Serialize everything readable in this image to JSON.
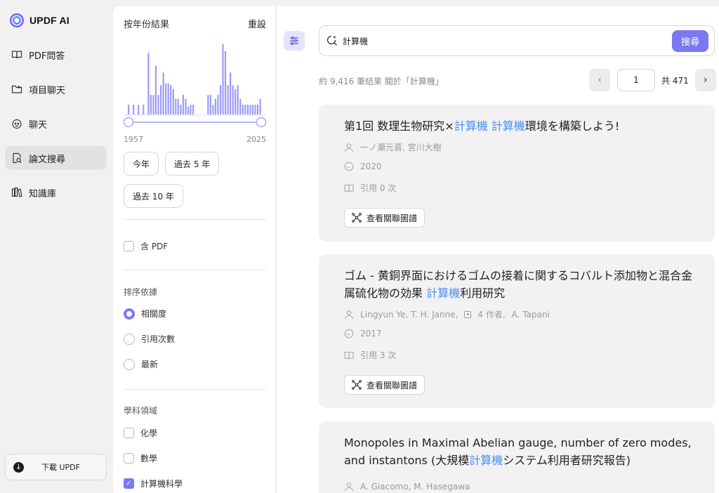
{
  "app": {
    "name": "UPDF AI"
  },
  "nav": [
    {
      "label": "PDF問答",
      "icon": "book-icon"
    },
    {
      "label": "項目聊天",
      "icon": "folder-icon"
    },
    {
      "label": "聊天",
      "icon": "chat-bot-icon"
    },
    {
      "label": "論文搜尋",
      "icon": "paper-search-icon",
      "active": true
    },
    {
      "label": "知識庫",
      "icon": "library-icon"
    }
  ],
  "download": {
    "label": "下載 UPDF"
  },
  "filters": {
    "year_title": "按年份結果",
    "reset_label": "重設",
    "year_min": "1957",
    "year_max": "2025",
    "year_chips": [
      "今年",
      "過去 5 年",
      "過去 10 年"
    ],
    "pdf_label": "含 PDF",
    "sort_title": "排序依據",
    "sort_options": [
      "相關度",
      "引用次數",
      "最新"
    ],
    "sort_selected": "相關度",
    "field_title": "學科領域",
    "fields": [
      {
        "label": "化學",
        "checked": false
      },
      {
        "label": "數學",
        "checked": false
      },
      {
        "label": "計算機科學",
        "checked": true
      }
    ],
    "year_histogram": [
      0.1,
      0,
      0.1,
      0,
      0.1,
      0,
      0.1,
      0,
      0.63,
      0.2,
      0.2,
      0.5,
      0.2,
      0.3,
      0.43,
      0.32,
      0.32,
      0.3,
      0.26,
      0.16,
      0.16,
      0.1,
      0.2,
      0.16,
      0.08,
      0.1,
      0.1,
      0,
      0,
      0,
      0,
      0,
      0.2,
      0.2,
      0.1,
      0.16,
      0.2,
      0.3,
      0.72,
      0.65,
      0.3,
      0.43,
      0.3,
      0.26,
      0.3,
      0.16,
      0.1,
      0.1,
      0.1,
      0.1,
      0.1,
      0.1,
      0.1,
      0.16
    ]
  },
  "search": {
    "query": "計算機",
    "button_label": "搜尋"
  },
  "results_summary": "約 9,416 筆結果 關於「計算機」",
  "pagination": {
    "current": "1",
    "total_label": "共 471"
  },
  "results": [
    {
      "title_parts": [
        {
          "t": "第1回 数理生物研究×",
          "hl": false
        },
        {
          "t": "計算機",
          "hl": true
        },
        {
          "t": " ",
          "hl": false
        },
        {
          "t": "計算機",
          "hl": true
        },
        {
          "t": "環境を構築しよう!",
          "hl": false
        }
      ],
      "authors": "一ノ瀬元喜, 宮川大樹",
      "year": "2020",
      "citations": "引用 0 次",
      "graph_label": "查看關聯圖譜"
    },
    {
      "title_parts": [
        {
          "t": "ゴム - 黄銅界面におけるゴムの接着に関するコバルト添加物と混合金属硫化物の効果 ",
          "hl": false
        },
        {
          "t": "計算機",
          "hl": true
        },
        {
          "t": "利用研究",
          "hl": false
        }
      ],
      "authors": "Lingyun Ye, T. H. Janne,",
      "authors_more": "4 作者,",
      "authors_last": "A. Tapani",
      "year": "2017",
      "citations": "引用 3 次",
      "graph_label": "查看關聯圖譜"
    },
    {
      "title_parts": [
        {
          "t": "Monopoles in Maximal Abelian gauge, number of zero modes, and instantons (大規模",
          "hl": false
        },
        {
          "t": "計算機",
          "hl": true
        },
        {
          "t": "システム利用者研究報告)",
          "hl": false
        }
      ],
      "authors": "A. Giacomo, M. Hasegawa"
    }
  ],
  "colors": {
    "accent": "#7b79f2",
    "highlight": "#4a8ef2",
    "card_bg": "#f2f2f3"
  }
}
